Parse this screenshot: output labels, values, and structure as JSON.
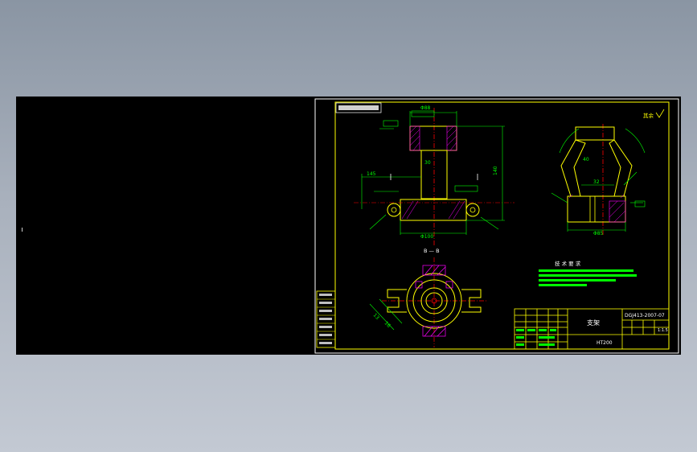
{
  "drawing": {
    "view_label": "B — B",
    "title_block": {
      "part_name": "支架",
      "drawing_number": "DGJ413-2007-07",
      "material": "HT200",
      "scale": "1:1.5"
    },
    "roughness_note": "其余",
    "tech_req_title": "技 术 要 求",
    "dimensions": [
      "Φ88",
      "Φ100",
      "Φ85",
      "140",
      "145",
      "30",
      "32",
      "40",
      "13",
      "16"
    ],
    "colors": {
      "sheet_bg": "#000000",
      "border": "#ffffff",
      "part_outline": "#ffff00",
      "dimension": "#00ff00",
      "centerline": "#ff0000",
      "hatch": "#ff00ff",
      "text": "#ffffff"
    }
  }
}
